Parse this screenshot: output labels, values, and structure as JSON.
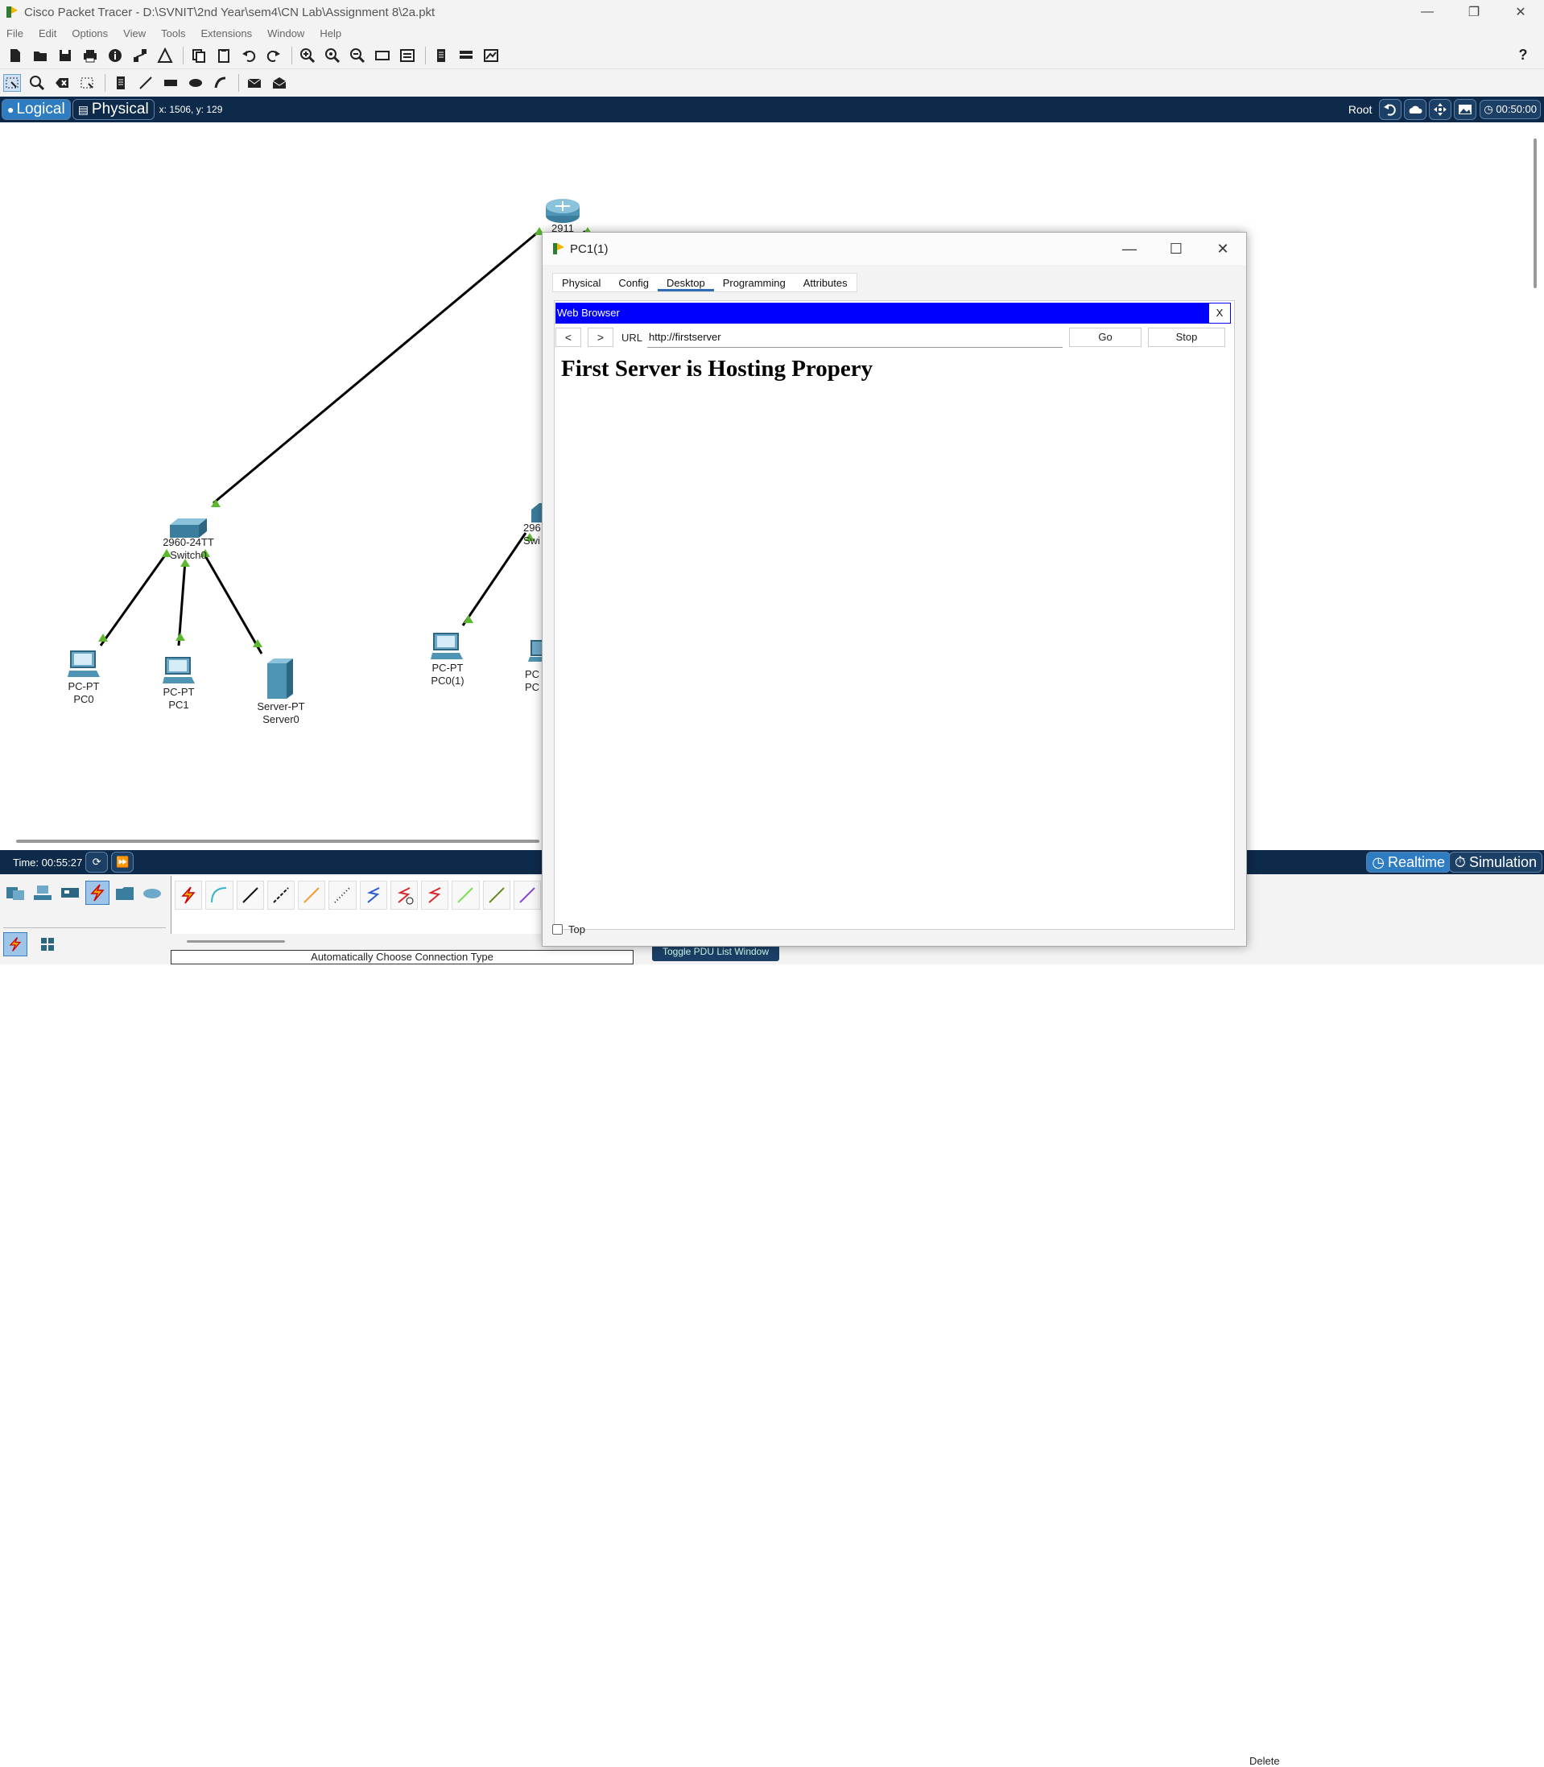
{
  "window": {
    "title": "Cisco Packet Tracer - D:\\SVNIT\\2nd Year\\sem4\\CN Lab\\Assignment 8\\2a.pkt",
    "minimize": "—",
    "restore": "❐",
    "close": "✕"
  },
  "menu": [
    "File",
    "Edit",
    "Options",
    "View",
    "Tools",
    "Extensions",
    "Window",
    "Help"
  ],
  "toolbar1": {
    "icons": [
      "new-file-icon",
      "open-folder-icon",
      "save-icon",
      "print-icon",
      "info-icon",
      "network-wizard-icon",
      "activity-wizard-icon",
      "copy-icon",
      "paste-icon",
      "undo-icon",
      "redo-icon",
      "zoom-in-icon",
      "zoom-reset-icon",
      "zoom-out-icon",
      "drawing-palette-icon",
      "custom-device-icon",
      "document-icon",
      "cluster-icon",
      "ipc-icon"
    ],
    "help": "?"
  },
  "workspace": {
    "logical_label": "Logical",
    "physical_label": "Physical",
    "coords": "x: 1506, y: 129",
    "root_label": "Root",
    "clock": "00:50:00"
  },
  "devices": [
    {
      "id": "router",
      "line1": "2911",
      "line2": ""
    },
    {
      "id": "switch0",
      "line1": "2960-24TT",
      "line2": "Switch0"
    },
    {
      "id": "switch1",
      "line1": "296",
      "line2": "Swi"
    },
    {
      "id": "pc0",
      "line1": "PC-PT",
      "line2": "PC0"
    },
    {
      "id": "pc1",
      "line1": "PC-PT",
      "line2": "PC1"
    },
    {
      "id": "server0",
      "line1": "Server-PT",
      "line2": "Server0"
    },
    {
      "id": "pc0-1",
      "line1": "PC-PT",
      "line2": "PC0(1)"
    },
    {
      "id": "pc1-1",
      "line1": "PC",
      "line2": "PC"
    }
  ],
  "bottom": {
    "time": "Time: 00:55:27",
    "realtime": "Realtime",
    "simulation": "Simulation",
    "connection_type": "Automatically Choose Connection Type",
    "pdu_toggle": "Toggle PDU List Window",
    "delete": "Delete"
  },
  "dialog": {
    "title": "PC1(1)",
    "tabs": [
      "Physical",
      "Config",
      "Desktop",
      "Programming",
      "Attributes"
    ],
    "active_tab": "Desktop",
    "browser": {
      "header": "Web Browser",
      "close": "X",
      "back": "<",
      "forward": ">",
      "url_label": "URL",
      "url_value": "http://firstserver",
      "go": "Go",
      "stop": "Stop",
      "page_heading": "First Server is Hosting Propery"
    },
    "top_checkbox_label": "Top"
  },
  "colors": {
    "workspace_bar": "#0e2a4a",
    "browser_header": "#0000ff",
    "link_arrow": "#5cb82e"
  }
}
